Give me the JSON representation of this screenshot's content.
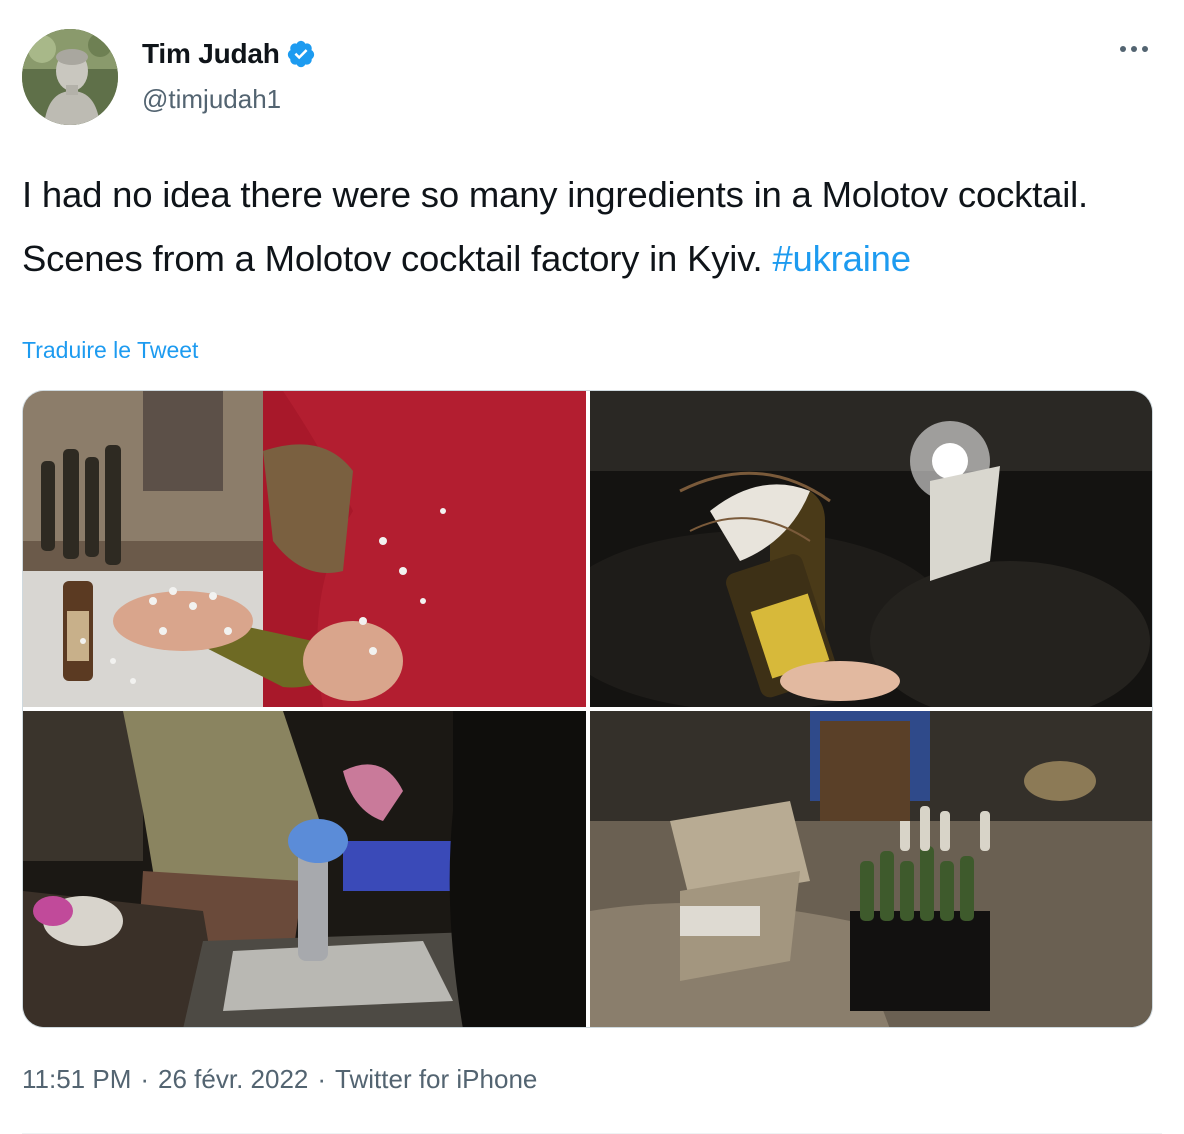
{
  "author": {
    "name": "Tim Judah",
    "handle": "@timjudah1",
    "verified": true,
    "avatar_icon": "statue-bust-avatar"
  },
  "tweet": {
    "text": "I had no idea there were so many ingredients in a Molotov cocktail. Scenes from a Molotov cocktail factory in Kyiv.",
    "hashtag": "#ukraine",
    "translate_label": "Traduire le Tweet"
  },
  "media": {
    "photos": [
      "hands-filling-wine-bottle-with-foam-beads-photo",
      "bottle-with-wick-held-in-dark-photo",
      "person-in-gloves-preparing-bottle-photo",
      "crates-of-bottles-and-boxes-photo"
    ]
  },
  "meta": {
    "time": "11:51 PM",
    "separator": "·",
    "date": "26 févr. 2022",
    "source": "Twitter for iPhone"
  },
  "colors": {
    "accent": "#1d9bf0",
    "text": "#0f1419",
    "secondary": "#536471"
  }
}
